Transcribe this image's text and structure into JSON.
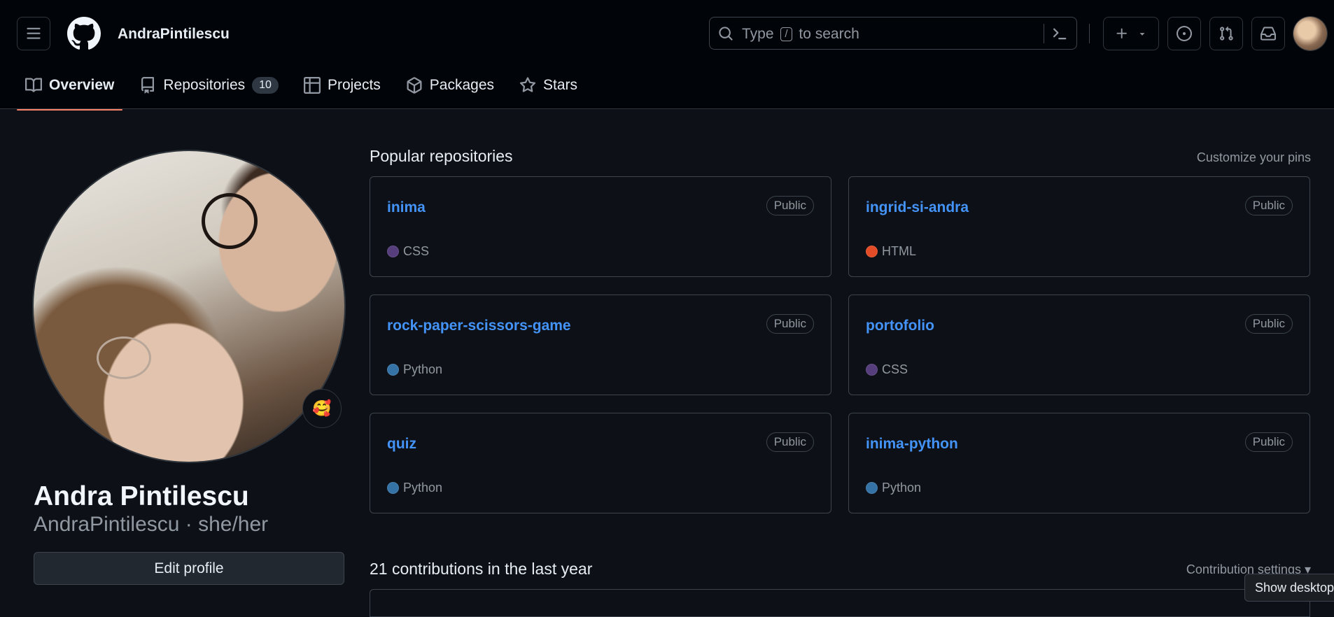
{
  "header": {
    "username": "AndraPintilescu",
    "search": {
      "prefix": "Type",
      "key": "/",
      "suffix": "to search"
    }
  },
  "tabs": [
    {
      "label": "Overview",
      "icon": "book-icon",
      "active": true
    },
    {
      "label": "Repositories",
      "icon": "repo-icon",
      "count": "10"
    },
    {
      "label": "Projects",
      "icon": "table-icon"
    },
    {
      "label": "Packages",
      "icon": "package-icon"
    },
    {
      "label": "Stars",
      "icon": "star-icon"
    }
  ],
  "profile": {
    "full_name": "Andra Pintilescu",
    "handle_line": "AndraPintilescu · she/her",
    "status_emoji": "🥰",
    "edit_button": "Edit profile"
  },
  "pinned": {
    "title": "Popular repositories",
    "customize": "Customize your pins",
    "repos": [
      {
        "name": "inima",
        "visibility": "Public",
        "language": "CSS",
        "color": "#563d7c"
      },
      {
        "name": "ingrid-si-andra",
        "visibility": "Public",
        "language": "HTML",
        "color": "#e34c26"
      },
      {
        "name": "rock-paper-scissors-game",
        "visibility": "Public",
        "language": "Python",
        "color": "#3572A5"
      },
      {
        "name": "portofolio",
        "visibility": "Public",
        "language": "CSS",
        "color": "#563d7c"
      },
      {
        "name": "quiz",
        "visibility": "Public",
        "language": "Python",
        "color": "#3572A5"
      },
      {
        "name": "inima-python",
        "visibility": "Public",
        "language": "Python",
        "color": "#3572A5"
      }
    ]
  },
  "contributions": {
    "title": "21 contributions in the last year",
    "settings": "Contribution settings ▾"
  },
  "tooltip": "Show desktop",
  "colors": {
    "accent_underline": "#f78166",
    "link": "#4493f8"
  }
}
